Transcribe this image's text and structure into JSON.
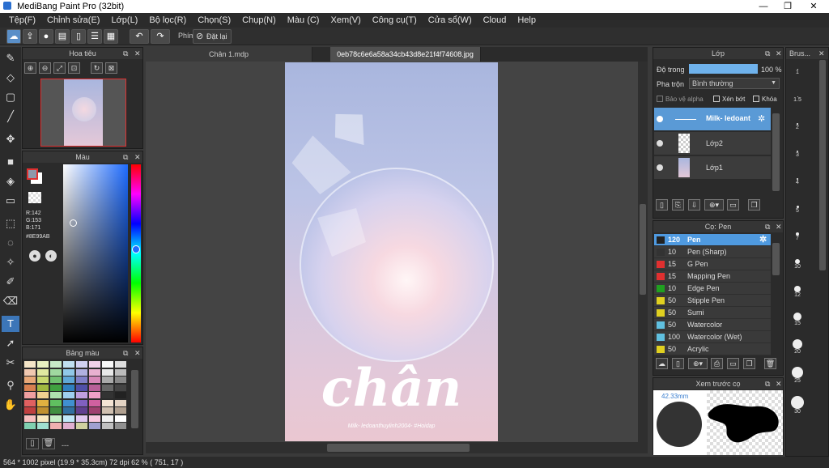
{
  "window": {
    "title": "MediBang Paint Pro (32bit)",
    "minimize": "—",
    "maximize": "❐",
    "close": "✕"
  },
  "menu": [
    "Tệp(F)",
    "Chỉnh sửa(E)",
    "Lớp(L)",
    "Bộ lọc(R)",
    "Chọn(S)",
    "Chụp(N)",
    "Màu (C)",
    "Xem(V)",
    "Công cụ(T)",
    "Cửa sổ(W)",
    "Cloud",
    "Help"
  ],
  "toolbar": {
    "hotkey_label": "Phím",
    "reset_label": "Đặt lại"
  },
  "navigator": {
    "title": "Hoa tiêu"
  },
  "color_panel": {
    "title": "Màu",
    "r": "R:142",
    "g": "G:153",
    "b": "B:171",
    "hex": "#8E99AB",
    "fg": "#8E99AB",
    "bg": "#ffffff"
  },
  "palette": {
    "title": "Bảng màu",
    "footer": "---"
  },
  "tabs": [
    {
      "label": "Chân 1.mdp"
    },
    {
      "label": "0eb78c6e6a58a34cb43d8e21f4f74608.jpg"
    }
  ],
  "artwork": {
    "word": "chân",
    "caption": "Milk- ledoanthuylinh2004-  #Hoidap"
  },
  "layer_panel": {
    "title": "Lớp",
    "opacity_label": "Độ trong",
    "opacity_value": "100 %",
    "opacity_fraction": 1.0,
    "blend_label": "Pha trộn",
    "blend_value": "Bình thường",
    "protect_alpha": "Bảo vệ alpha",
    "clip": "Xén bớt",
    "lock": "Khóa",
    "layers": [
      {
        "name": "Milk- ledoant"
      },
      {
        "name": "Lớp2"
      },
      {
        "name": "Lớp1"
      }
    ]
  },
  "brush_panel": {
    "title": "Cọ: Pen",
    "brushes": [
      {
        "size": "120",
        "name": "Pen",
        "color": "#222222"
      },
      {
        "size": "10",
        "name": "Pen (Sharp)",
        "color": "#333333"
      },
      {
        "size": "15",
        "name": "G Pen",
        "color": "#e03030"
      },
      {
        "size": "15",
        "name": "Mapping Pen",
        "color": "#e03030"
      },
      {
        "size": "10",
        "name": "Edge Pen",
        "color": "#20a020"
      },
      {
        "size": "50",
        "name": "Stipple Pen",
        "color": "#e0d020"
      },
      {
        "size": "50",
        "name": "Sumi",
        "color": "#e0d020"
      },
      {
        "size": "50",
        "name": "Watercolor",
        "color": "#60c0e0"
      },
      {
        "size": "100",
        "name": "Watercolor (Wet)",
        "color": "#60c0e0"
      },
      {
        "size": "50",
        "name": "Acrylic",
        "color": "#e0d020"
      }
    ]
  },
  "preview_panel": {
    "title": "Xem trước cọ",
    "size_label": "42.33mm"
  },
  "brush_size_panel": {
    "title": "Brus...",
    "sizes": [
      "1",
      "1.5",
      "2",
      "3",
      "4",
      "5",
      "7",
      "10",
      "12",
      "15",
      "20",
      "25",
      "30"
    ]
  },
  "status": {
    "dims": "564 * 1002 pixel",
    "cm": "(19.9 * 35.3cm)",
    "dpi": "72 dpi",
    "zoom": "62 %",
    "coords": "( 751, 17 )"
  }
}
